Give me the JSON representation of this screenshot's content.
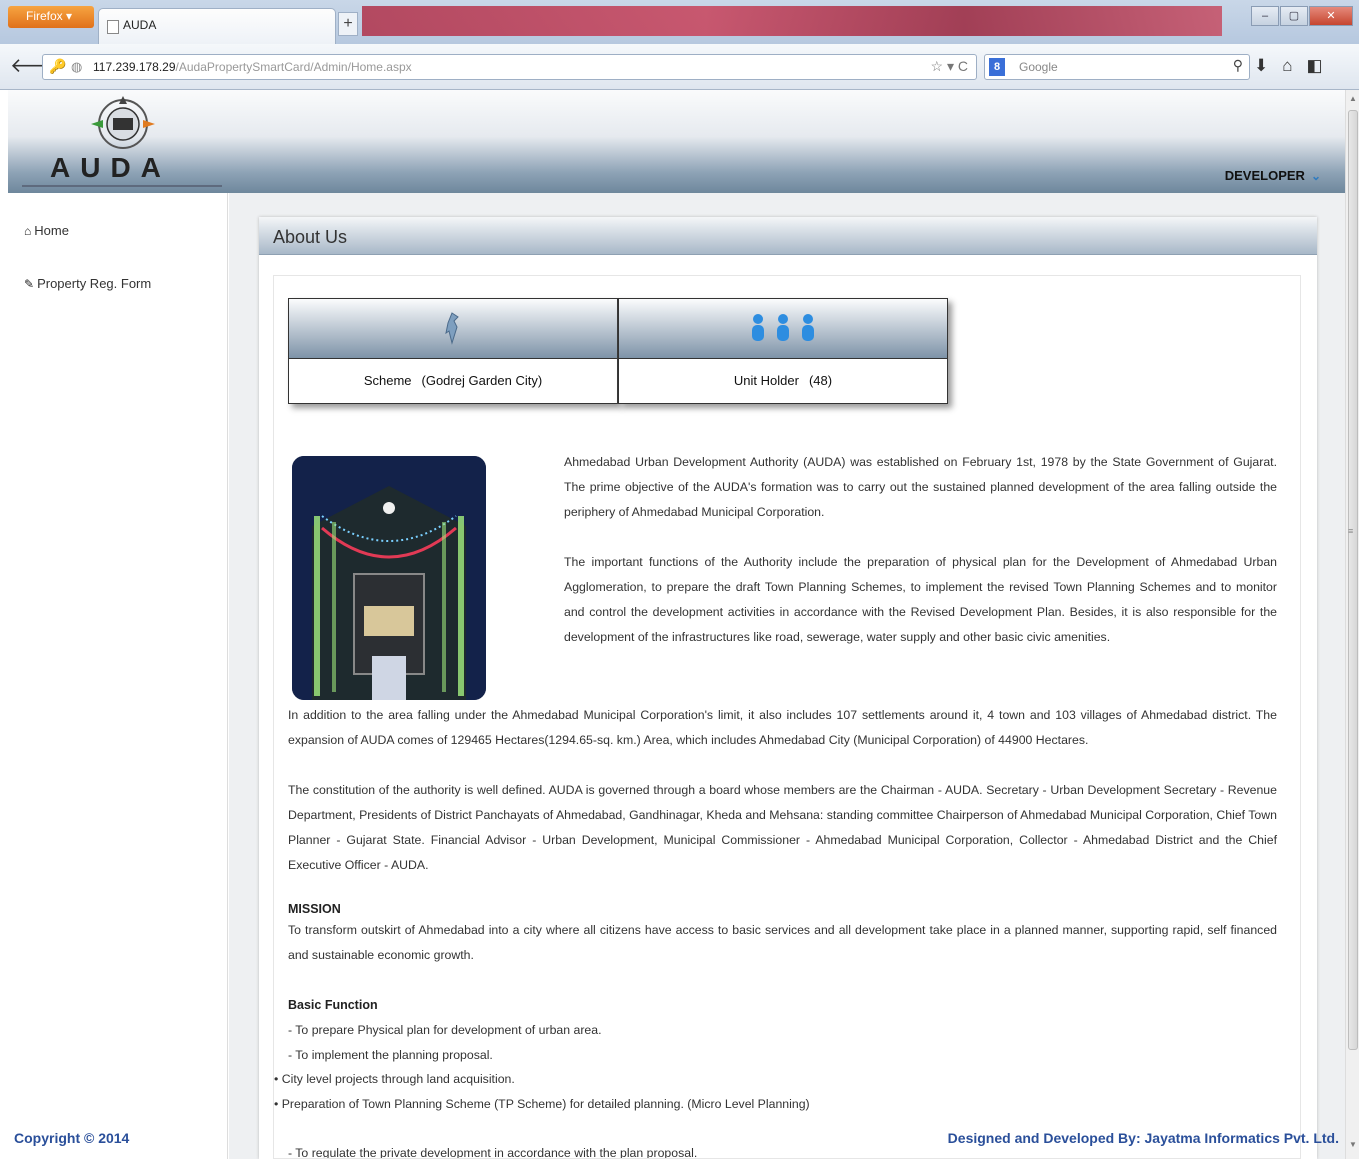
{
  "browser": {
    "app_button": "Firefox",
    "tab_title": "AUDA",
    "new_tab": "+",
    "url_host": "117.239.178.29",
    "url_path": "/AudaPropertySmartCard/Admin/Home.aspx",
    "url_tools": "☆ ▾ C",
    "search_engine": "8",
    "search_placeholder": "Google",
    "window_min": "–",
    "window_max": "▢",
    "window_close": "✕"
  },
  "header": {
    "logo_text": "AUDA",
    "user_menu": "DEVELOPER"
  },
  "sidebar": {
    "items": [
      {
        "icon": "home-icon",
        "label": "Home"
      },
      {
        "icon": "edit-icon",
        "label": "Property Reg. Form"
      }
    ]
  },
  "panel": {
    "title": "About Us"
  },
  "stats": {
    "scheme_label": "Scheme",
    "scheme_value": "(Godrej Garden City)",
    "unit_label": "Unit Holder",
    "unit_value": "(48)"
  },
  "content": {
    "p1": "Ahmedabad Urban Development Authority (AUDA) was established on February 1st, 1978 by the State Government of Gujarat. The prime objective of the AUDA's formation was to carry out the sustained planned development of the area falling outside the periphery of Ahmedabad Municipal Corporation.",
    "p2": "The important functions of the Authority include the preparation of physical plan for the Development of Ahmedabad Urban Agglomeration, to prepare the draft Town Planning Schemes, to implement the revised Town Planning Schemes and to monitor and control the development activities in accordance with the Revised Development Plan. Besides, it is also responsible for the development of the infrastructures like road, sewerage, water supply and other basic civic amenities.",
    "p3": "In addition to the area falling under the Ahmedabad Municipal Corporation's limit, it also includes 107 settlements around it, 4 town and 103 villages of Ahmedabad district. The expansion of AUDA comes of 129465 Hectares(1294.65-sq. km.) Area, which includes Ahmedabad City (Municipal Corporation) of 44900 Hectares.",
    "p4": "The constitution of the authority is well defined. AUDA is governed through a board whose members are the Chairman - AUDA. Secretary - Urban Development Secretary - Revenue Department, Presidents of District Panchayats of Ahmedabad, Gandhinagar, Kheda and Mehsana: standing committee Chairperson of Ahmedabad Municipal Corporation, Chief Town Planner - Gujarat State. Financial Advisor - Urban Development, Municipal Commissioner - Ahmedabad Municipal Corporation, Collector - Ahmedabad District and the Chief Executive Officer - AUDA.",
    "mission_head": "MISSION",
    "mission_text": "To transform outskirt of Ahmedabad into a city where all citizens have access to basic services and all development take place in a planned manner, supporting rapid, self financed and sustainable economic growth.",
    "function_head": "Basic Function",
    "functions": [
      "- To prepare Physical plan for development of urban area.",
      "- To implement the planning proposal.",
      "• City level projects through land acquisition.",
      "• Preparation of Town Planning Scheme (TP Scheme) for detailed planning. (Micro Level Planning)",
      "- To regulate the private development in accordance with the plan proposal."
    ]
  },
  "footer": {
    "copyright": "Copyright © 2014",
    "credit": "Designed and Developed By: Jayatma Informatics Pvt. Ltd."
  }
}
